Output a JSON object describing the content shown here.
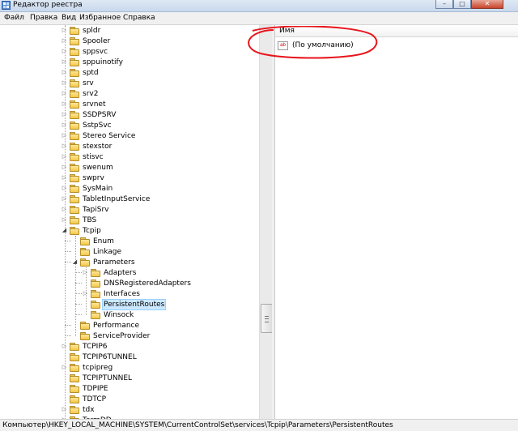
{
  "window": {
    "title": "Редактор реестра"
  },
  "menu": [
    "Файл",
    "Правка",
    "Вид",
    "Избранное",
    "Справка"
  ],
  "tree": {
    "items": [
      {
        "label": "spldr",
        "level": 0,
        "expander": "collapsed"
      },
      {
        "label": "Spooler",
        "level": 0,
        "expander": "collapsed"
      },
      {
        "label": "sppsvc",
        "level": 0,
        "expander": "collapsed"
      },
      {
        "label": "sppuinotify",
        "level": 0,
        "expander": "collapsed"
      },
      {
        "label": "sptd",
        "level": 0,
        "expander": "collapsed"
      },
      {
        "label": "srv",
        "level": 0,
        "expander": "collapsed"
      },
      {
        "label": "srv2",
        "level": 0,
        "expander": "collapsed"
      },
      {
        "label": "srvnet",
        "level": 0,
        "expander": "collapsed"
      },
      {
        "label": "SSDPSRV",
        "level": 0,
        "expander": "collapsed"
      },
      {
        "label": "SstpSvc",
        "level": 0,
        "expander": "collapsed"
      },
      {
        "label": "Stereo Service",
        "level": 0,
        "expander": "collapsed"
      },
      {
        "label": "stexstor",
        "level": 0,
        "expander": "collapsed"
      },
      {
        "label": "stisvc",
        "level": 0,
        "expander": "collapsed"
      },
      {
        "label": "swenum",
        "level": 0,
        "expander": "collapsed"
      },
      {
        "label": "swprv",
        "level": 0,
        "expander": "collapsed"
      },
      {
        "label": "SysMain",
        "level": 0,
        "expander": "collapsed"
      },
      {
        "label": "TabletInputService",
        "level": 0,
        "expander": "collapsed"
      },
      {
        "label": "TapiSrv",
        "level": 0,
        "expander": "collapsed"
      },
      {
        "label": "TBS",
        "level": 0,
        "expander": "collapsed"
      },
      {
        "label": "Tcpip",
        "level": 0,
        "expander": "expanded"
      },
      {
        "label": "Enum",
        "level": 1,
        "expander": "none"
      },
      {
        "label": "Linkage",
        "level": 1,
        "expander": "none"
      },
      {
        "label": "Parameters",
        "level": 1,
        "expander": "expanded"
      },
      {
        "label": "Adapters",
        "level": 2,
        "expander": "collapsed"
      },
      {
        "label": "DNSRegisteredAdapters",
        "level": 2,
        "expander": "none"
      },
      {
        "label": "Interfaces",
        "level": 2,
        "expander": "collapsed"
      },
      {
        "label": "PersistentRoutes",
        "level": 2,
        "expander": "none",
        "selected": true
      },
      {
        "label": "Winsock",
        "level": 2,
        "expander": "none"
      },
      {
        "label": "Performance",
        "level": 1,
        "expander": "none"
      },
      {
        "label": "ServiceProvider",
        "level": 1,
        "expander": "none"
      },
      {
        "label": "TCPIP6",
        "level": 0,
        "expander": "collapsed"
      },
      {
        "label": "TCPIP6TUNNEL",
        "level": 0,
        "expander": "none"
      },
      {
        "label": "tcpipreg",
        "level": 0,
        "expander": "collapsed"
      },
      {
        "label": "TCPIPTUNNEL",
        "level": 0,
        "expander": "none"
      },
      {
        "label": "TDPIPE",
        "level": 0,
        "expander": "none"
      },
      {
        "label": "TDTCP",
        "level": 0,
        "expander": "none"
      },
      {
        "label": "tdx",
        "level": 0,
        "expander": "collapsed"
      },
      {
        "label": "TermDD",
        "level": 0,
        "expander": "collapsed"
      }
    ]
  },
  "values_pane": {
    "column_name": "Имя",
    "entries": [
      {
        "icon": "string-value-icon",
        "icon_text": "ab",
        "name": "(По умолчанию)"
      }
    ]
  },
  "status_bar": {
    "path": "Компьютер\\HKEY_LOCAL_MACHINE\\SYSTEM\\CurrentControlSet\\services\\Tcpip\\Parameters\\PersistentRoutes"
  },
  "colors": {
    "selection": "#cce8ff",
    "annotation": "#e8141b",
    "folder": "#f3c847"
  }
}
